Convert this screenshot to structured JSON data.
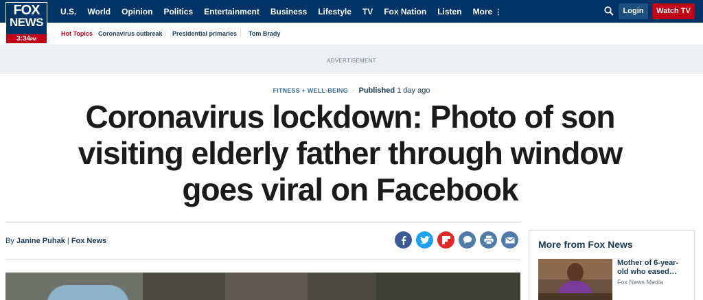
{
  "logo": {
    "line1": "FOX",
    "line2": "NEWS",
    "clock": "3:34",
    "clock_suffix": "PM"
  },
  "nav": {
    "items": [
      "U.S.",
      "World",
      "Opinion",
      "Politics",
      "Entertainment",
      "Business",
      "Lifestyle",
      "TV",
      "Fox Nation",
      "Listen",
      "More"
    ],
    "login_label": "Login",
    "watch_label": "Watch TV"
  },
  "hot_topics": {
    "label": "Hot Topics",
    "items": [
      "Coronavirus outbreak",
      "Presidential primaries",
      "Tom Brady"
    ]
  },
  "ad": {
    "label": "ADVERTISEMENT"
  },
  "article": {
    "category": "FITNESS + WELL-BEING",
    "published_label": "Published",
    "published_ago": "1 day ago",
    "headline": "Coronavirus lockdown: Photo of son visiting elderly father through window goes viral on Facebook",
    "byline_prefix": "By",
    "author": "Janine Puhak",
    "separator": "|",
    "outlet": "Fox News"
  },
  "share": [
    {
      "name": "facebook",
      "color": "#3b5998"
    },
    {
      "name": "twitter",
      "color": "#1da1f2"
    },
    {
      "name": "flipboard",
      "color": "#e12828"
    },
    {
      "name": "comments",
      "color": "#4f7ba8"
    },
    {
      "name": "print",
      "color": "#4f7ba8"
    },
    {
      "name": "email",
      "color": "#4f7ba8"
    }
  ],
  "sidebar": {
    "title": "More from Fox News",
    "story_headline": "Mother of 6-year-old who eased…",
    "story_source": "Fox News Media"
  },
  "colors": {
    "nav_bg": "#003366",
    "accent_red": "#c20017",
    "text_navy": "#183a52"
  }
}
